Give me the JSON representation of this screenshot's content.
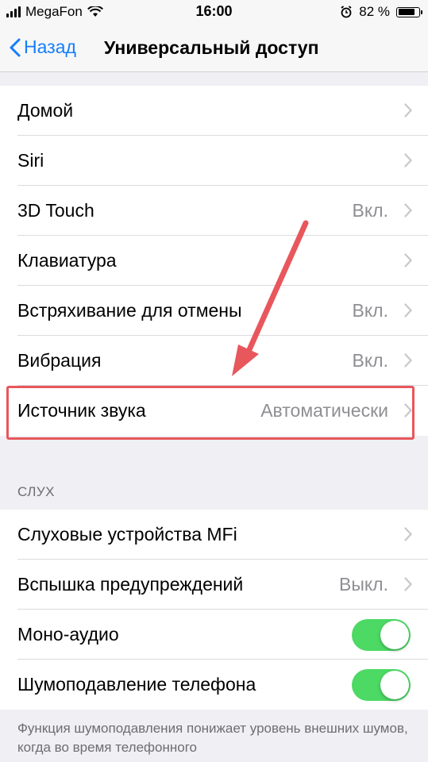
{
  "status_bar": {
    "carrier": "MegaFon",
    "time": "16:00",
    "battery": "82 %",
    "battery_level": 0.82
  },
  "nav": {
    "back_label": "Назад",
    "title": "Универсальный доступ"
  },
  "group1": {
    "rows": [
      {
        "label": "Домой",
        "value": ""
      },
      {
        "label": "Siri",
        "value": ""
      },
      {
        "label": "3D Touch",
        "value": "Вкл."
      },
      {
        "label": "Клавиатура",
        "value": ""
      },
      {
        "label": "Встряхивание для отмены",
        "value": "Вкл."
      },
      {
        "label": "Вибрация",
        "value": "Вкл."
      },
      {
        "label": "Источник звука",
        "value": "Автоматически"
      }
    ]
  },
  "hearing": {
    "header": "СЛУХ",
    "rows": [
      {
        "label": "Слуховые устройства MFi",
        "value": ""
      },
      {
        "label": "Вспышка предупреждений",
        "value": "Выкл."
      },
      {
        "label": "Моно-аудио",
        "toggle": true
      },
      {
        "label": "Шумоподавление телефона",
        "toggle": true
      }
    ],
    "footer": "Функция шумоподавления понижает уровень внешних шумов, когда во время телефонного"
  },
  "colors": {
    "accent": "#147efb",
    "toggle_on": "#4cd964",
    "annotation": "#e8575c"
  }
}
